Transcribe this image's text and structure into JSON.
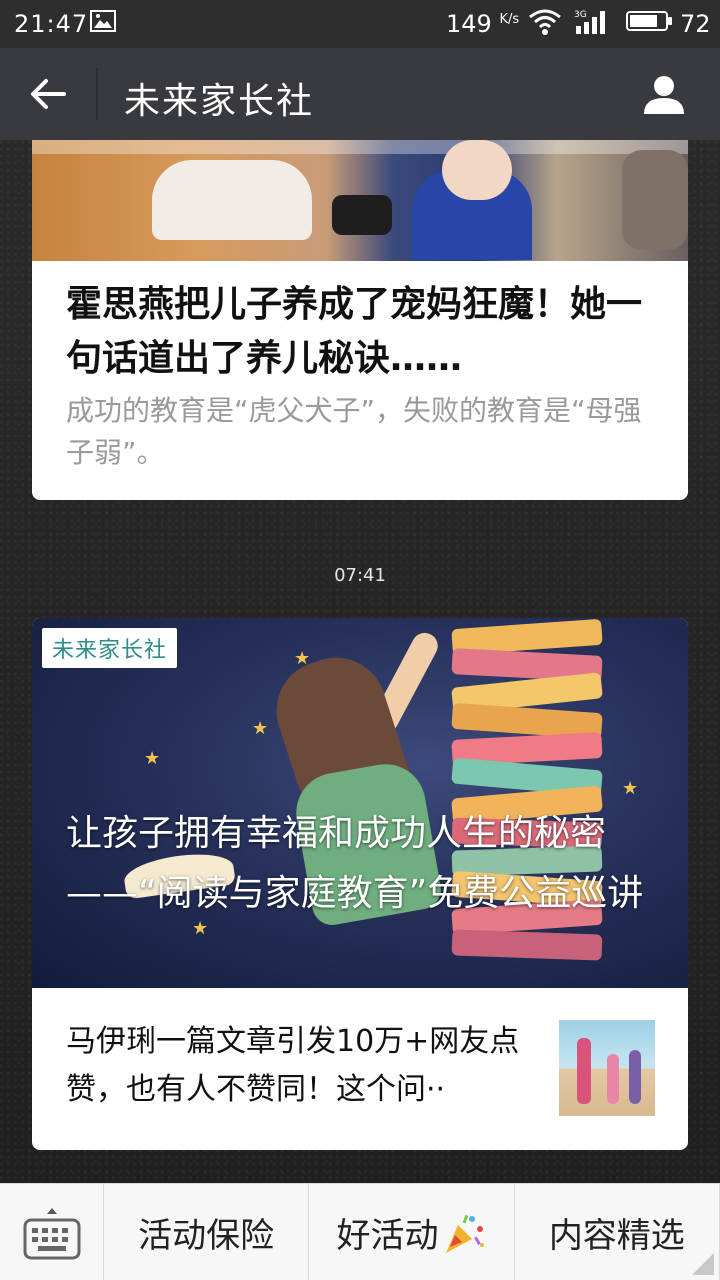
{
  "status_bar": {
    "time": "21:47",
    "speed": "149",
    "speed_unit": "K/s",
    "network": "3G",
    "battery": "72"
  },
  "header": {
    "title": "未来家长社"
  },
  "articles": [
    {
      "title": "霍思燕把儿子养成了宠妈狂魔！她一句话道出了养儿秘诀……",
      "digest": "成功的教育是“虎父犬子”，失败的教育是“母强子弱”。"
    }
  ],
  "timestamp": "07:41",
  "feature": {
    "brand_tag": "未来家长社",
    "cover_title": "让孩子拥有幸福和成功人生的秘密——“阅读与家庭教育”免费公益巡讲",
    "sub_article_title": "马伊琍一篇文章引发10万+网友点赞，也有人不赞同！这个问··"
  },
  "bottom_menu": {
    "items": [
      "活动保险",
      "好活动",
      "内容精选"
    ]
  },
  "colors": {
    "titlebar_bg": "#393a3f",
    "statusbar_bg": "#2e2e2e",
    "menu_bg": "#f7f7f7",
    "brand_tag_text": "#2c8e8a"
  }
}
